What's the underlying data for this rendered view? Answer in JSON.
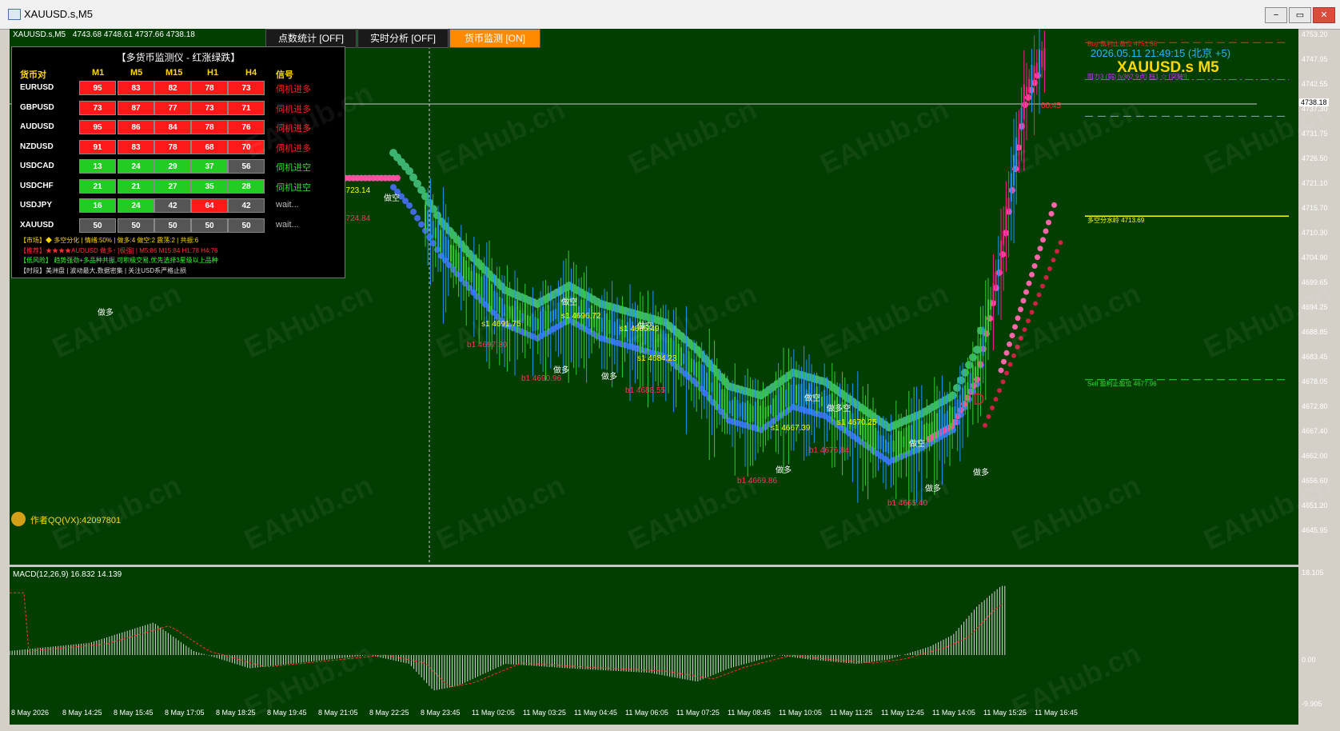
{
  "window": {
    "title": "XAUUSD.s,M5",
    "buttons": [
      "−",
      "▭",
      "✕"
    ]
  },
  "chart": {
    "symbol_line": {
      "symbol": "XAUUSD.s,M5",
      "ohlc": "4743.68 4748.61 4737.66 4738.18"
    },
    "tabs": [
      {
        "label": "点数统计 [OFF]",
        "on": false
      },
      {
        "label": "实时分析 [OFF]",
        "on": false
      },
      {
        "label": "货币监测 [ON]",
        "on": true
      }
    ],
    "datetime": "2026.05.11 21:49:15 (北京 +5)",
    "big_symbol": "XAUUSD.s M5",
    "current_price": "4738.18",
    "countdown": "00:45",
    "author": "作者QQ(VX):42097801",
    "levels": {
      "buy_stop": "Buy 盈利止盈位 4751.58",
      "resist": "阻力3 (弱) [v362.9点] 档1 ☆ [突破!]",
      "split": "多空分水岭 4713.69",
      "sell_stop": "Sell 盈利止盈位 4677.96"
    },
    "price_axis": [
      "4753.20",
      "4747.95",
      "4742.55",
      "4737.30",
      "4731.75",
      "4726.50",
      "4721.10",
      "4715.70",
      "4710.30",
      "4704.90",
      "4699.65",
      "4694.25",
      "4688.85",
      "4683.45",
      "4678.05",
      "4672.80",
      "4667.40",
      "4662.00",
      "4656.60",
      "4651.20",
      "4645.95"
    ],
    "macd_axis": [
      "18.105",
      "0.00",
      "-9.905"
    ],
    "macd_label": "MACD(12,26,9) 16.832 14.139",
    "time_axis": [
      "8 May 2026",
      "8 May 14:25",
      "8 May 15:45",
      "8 May 17:05",
      "8 May 18:25",
      "8 May 19:45",
      "8 May 21:05",
      "8 May 22:25",
      "8 May 23:45",
      "11 May 02:05",
      "11 May 03:25",
      "11 May 04:45",
      "11 May 06:05",
      "11 May 07:25",
      "11 May 08:45",
      "11 May 10:05",
      "11 May 11:25",
      "11 May 12:45",
      "11 May 14:05",
      "11 May 15:25",
      "11 May 16:45"
    ],
    "annotations": [
      {
        "text": "4723.14",
        "color": "#ffff00"
      },
      {
        "text": "4724.84",
        "color": "#ff3366"
      },
      {
        "text": "做空",
        "color": "#ffffff"
      },
      {
        "text": "做多",
        "color": "#ffffff"
      },
      {
        "text": "s1 4691.75",
        "color": "#ffff00"
      },
      {
        "text": "b1 4697.30",
        "color": "#ff3366"
      },
      {
        "text": "做空",
        "color": "#ffffff"
      },
      {
        "text": "s1 4696.72",
        "color": "#ffff00"
      },
      {
        "text": "b1 4690.96",
        "color": "#ff3366"
      },
      {
        "text": "做多",
        "color": "#ffffff"
      },
      {
        "text": "s1 4685.49",
        "color": "#ffff00"
      },
      {
        "text": "做多",
        "color": "#ffffff"
      },
      {
        "text": "做空",
        "color": "#ffffff"
      },
      {
        "text": "s1 4684.23",
        "color": "#ffff00"
      },
      {
        "text": "b1 4688.55",
        "color": "#ff3366"
      },
      {
        "text": "做空",
        "color": "#ffffff"
      },
      {
        "text": "s1 4667.39",
        "color": "#ffff00"
      },
      {
        "text": "做多",
        "color": "#ffffff"
      },
      {
        "text": "b1 4669.86",
        "color": "#ff3366"
      },
      {
        "text": "做多空",
        "color": "#ffffff"
      },
      {
        "text": "s1 4670.25",
        "color": "#ffff00"
      },
      {
        "text": "b1 4676.84",
        "color": "#ff3366"
      },
      {
        "text": "做空",
        "color": "#ffffff"
      },
      {
        "text": "做多",
        "color": "#ffffff"
      },
      {
        "text": "b1 4665.40",
        "color": "#ff3366"
      },
      {
        "text": "做多",
        "color": "#ffffff"
      }
    ]
  },
  "monitor": {
    "title": "【多货币监测仪 - 红涨绿跌】",
    "headers": [
      "货币对",
      "M1",
      "M5",
      "M15",
      "H1",
      "H4",
      "信号"
    ],
    "rows": [
      {
        "pair": "EURUSD",
        "vals": [
          "95",
          "83",
          "82",
          "78",
          "73"
        ],
        "colors": [
          "#ff1a1a",
          "#ff1a1a",
          "#ff1a1a",
          "#ff1a1a",
          "#ff1a1a"
        ],
        "signal": "伺机进多",
        "sigcolor": "#ff2222"
      },
      {
        "pair": "GBPUSD",
        "vals": [
          "73",
          "87",
          "77",
          "73",
          "71"
        ],
        "colors": [
          "#ff1a1a",
          "#ff1a1a",
          "#ff1a1a",
          "#ff1a1a",
          "#ff1a1a"
        ],
        "signal": "伺机进多",
        "sigcolor": "#ff2222"
      },
      {
        "pair": "AUDUSD",
        "vals": [
          "95",
          "86",
          "84",
          "78",
          "76"
        ],
        "colors": [
          "#ff1a1a",
          "#ff1a1a",
          "#ff1a1a",
          "#ff1a1a",
          "#ff1a1a"
        ],
        "signal": "伺机进多",
        "sigcolor": "#ff2222"
      },
      {
        "pair": "NZDUSD",
        "vals": [
          "91",
          "83",
          "78",
          "68",
          "70"
        ],
        "colors": [
          "#ff1a1a",
          "#ff1a1a",
          "#ff1a1a",
          "#ff1a1a",
          "#ff1a1a"
        ],
        "signal": "伺机进多",
        "sigcolor": "#ff2222"
      },
      {
        "pair": "USDCAD",
        "vals": [
          "13",
          "24",
          "29",
          "37",
          "56"
        ],
        "colors": [
          "#22cc22",
          "#22cc22",
          "#22cc22",
          "#22cc22",
          "#555555"
        ],
        "signal": "伺机进空",
        "sigcolor": "#33dd33"
      },
      {
        "pair": "USDCHF",
        "vals": [
          "21",
          "21",
          "27",
          "35",
          "28"
        ],
        "colors": [
          "#22cc22",
          "#22cc22",
          "#22cc22",
          "#22cc22",
          "#22cc22"
        ],
        "signal": "伺机进空",
        "sigcolor": "#33dd33"
      },
      {
        "pair": "USDJPY",
        "vals": [
          "16",
          "24",
          "42",
          "64",
          "42"
        ],
        "colors": [
          "#22cc22",
          "#22cc22",
          "#555555",
          "#ff1a1a",
          "#555555"
        ],
        "signal": "wait...",
        "sigcolor": "#bbbbbb"
      },
      {
        "pair": "XAUUSD",
        "vals": [
          "50",
          "50",
          "50",
          "50",
          "50"
        ],
        "colors": [
          "#555555",
          "#555555",
          "#555555",
          "#555555",
          "#555555"
        ],
        "signal": "wait...",
        "sigcolor": "#bbbbbb"
      }
    ],
    "notes": [
      {
        "text": "【市场】◆ 多空分化 | 情绪:50% | 做多:4 做空:2 震荡:2 | 共振:6",
        "color": "#ffd700"
      },
      {
        "text": "【推荐】★★★★AUDUSD 做多↑ [极强] | M5:86 M15:84 H1:78 H4:76",
        "color": "#ff3333"
      },
      {
        "text": "【低风险】 趋势强劲+多品种共振,可积极交易,优先选择3星级以上品种",
        "color": "#33ff33"
      },
      {
        "text": "【时段】美洲盘 | 波动最大,数据密集 | 关注USD系严格止损",
        "color": "#dddddd"
      }
    ]
  },
  "watermark": "EAHub.cn",
  "colors": {
    "bg": "#023d02",
    "bull": "#33cc33",
    "bear": "#1e90ff",
    "band_green": "#3cb371",
    "band_blue": "#4169e1",
    "band_pink": "#ff4fa0"
  }
}
